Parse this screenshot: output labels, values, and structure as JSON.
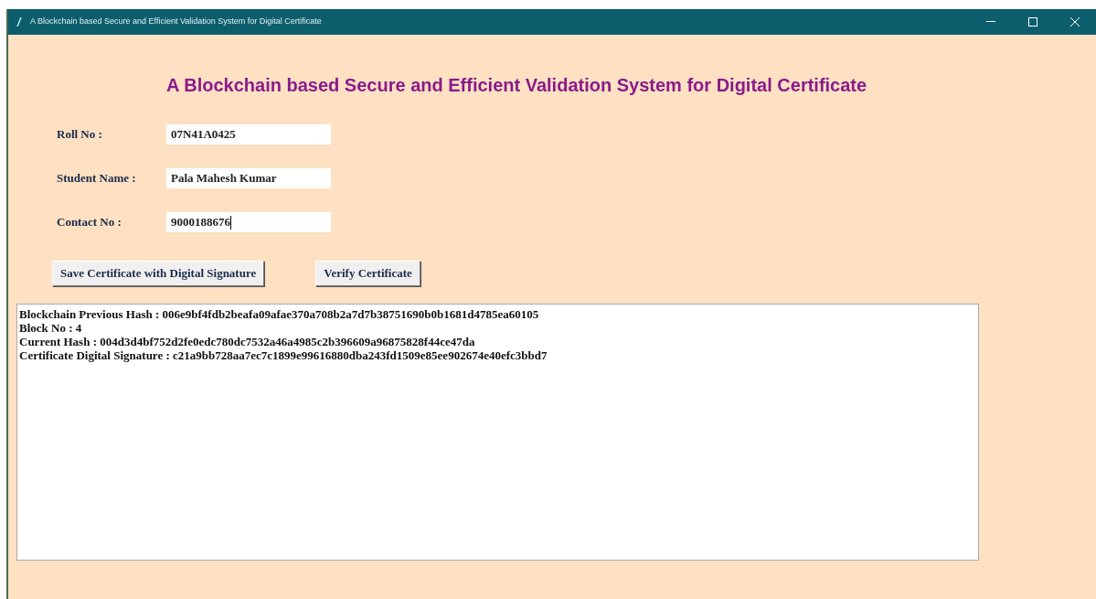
{
  "window": {
    "title": "A Blockchain based Secure and Efficient Validation System for Digital Certificate"
  },
  "heading": "A Blockchain based Secure and Efficient Validation System for Digital Certificate",
  "fields": [
    {
      "label": "Roll No :",
      "value": "07N41A0425",
      "focused": false
    },
    {
      "label": "Student Name :",
      "value": "Pala Mahesh Kumar",
      "focused": false
    },
    {
      "label": "Contact No :",
      "value": "9000188676",
      "focused": true
    }
  ],
  "buttons": [
    "Save Certificate with Digital Signature",
    "Verify Certificate"
  ],
  "output": {
    "lines": [
      "Blockchain Previous Hash : 006e9bf4fdb2beafa09afae370a708b2a7d7b38751690b0b1681d4785ea60105",
      "Block No : 4",
      "Current Hash : 004d3d4bf752d2fe0edc780dc7532a46a4985c2b396609a96875828f44ce47da",
      "Certificate Digital Signature : c21a9bb728aa7ec7c1899e99616880dba243fd1509e85ee902674e40efc3bbd7"
    ]
  }
}
